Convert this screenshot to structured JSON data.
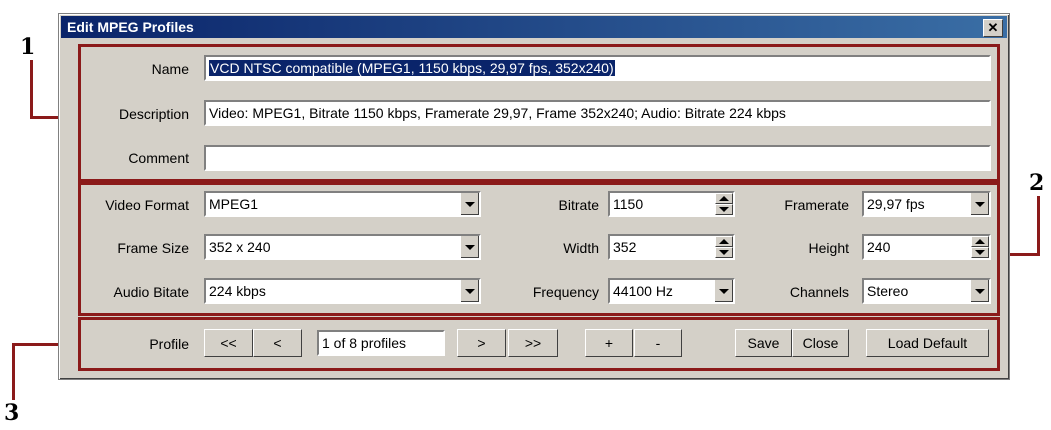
{
  "window": {
    "title": "Edit MPEG Profiles",
    "close_glyph": "✕"
  },
  "callouts": {
    "one": "1",
    "two": "2",
    "three": "3"
  },
  "section1": {
    "name_label": "Name",
    "name_value": "VCD NTSC compatible (MPEG1, 1150 kbps, 29,97 fps, 352x240)",
    "description_label": "Description",
    "description_value": "Video: MPEG1, Bitrate 1150 kbps, Framerate 29,97, Frame 352x240; Audio: Bitrate 224 kbps",
    "comment_label": "Comment",
    "comment_value": ""
  },
  "section2": {
    "video_format_label": "Video Format",
    "video_format_value": "MPEG1",
    "bitrate_label": "Bitrate",
    "bitrate_value": "1150",
    "framerate_label": "Framerate",
    "framerate_value": "29,97 fps",
    "frame_size_label": "Frame Size",
    "frame_size_value": "352 x 240",
    "width_label": "Width",
    "width_value": "352",
    "height_label": "Height",
    "height_value": "240",
    "audio_bitrate_label": "Audio Bitate",
    "audio_bitrate_value": "224 kbps",
    "frequency_label": "Frequency",
    "frequency_value": "44100 Hz",
    "channels_label": "Channels",
    "channels_value": "Stereo"
  },
  "section3": {
    "profile_label": "Profile",
    "first": "<<",
    "prev": "<",
    "position": "1 of 8 profiles",
    "next": ">",
    "last": ">>",
    "add": "+",
    "remove": "-",
    "save": "Save",
    "close": "Close",
    "load_default": "Load Default"
  },
  "colors": {
    "callout": "#8b1a1a",
    "face": "#d4d0c8",
    "title_start": "#0a246a",
    "title_end": "#3a6ea5"
  }
}
